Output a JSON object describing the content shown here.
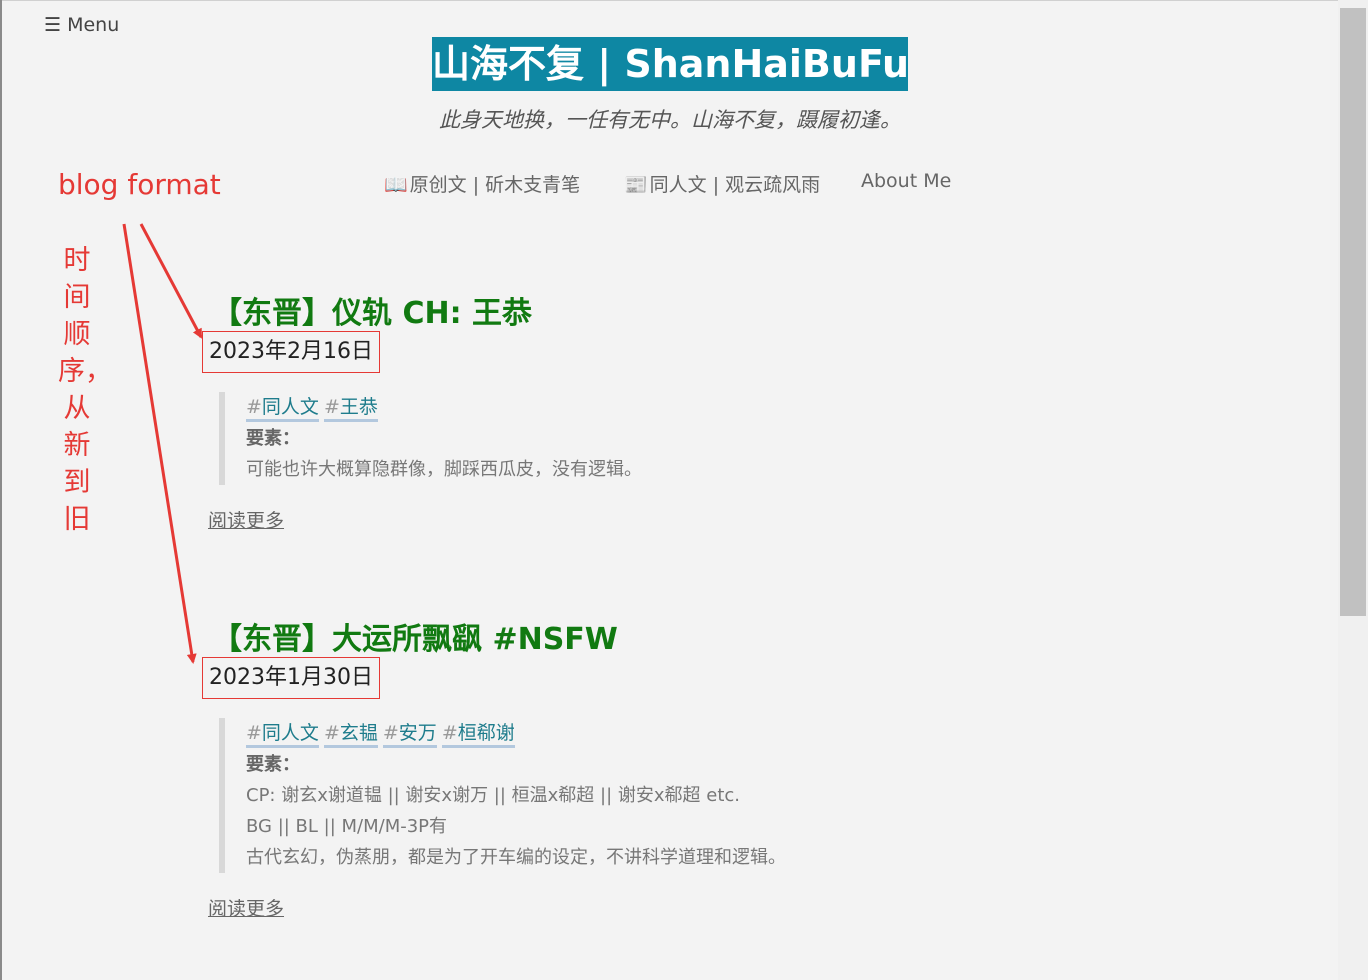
{
  "header": {
    "menu_label": "☰ Menu",
    "site_title": "山海不复 | ShanHaiBuFu",
    "tagline": "此身天地换，一任有无中。山海不复，蹑履初逢。"
  },
  "nav": {
    "items": [
      {
        "icon": "📖",
        "label": "原创文 | 斫木支青笔"
      },
      {
        "icon": "📰",
        "label": "同人文 | 观云疏风雨"
      },
      {
        "icon": "",
        "label": "About Me"
      }
    ]
  },
  "annotations": {
    "format_label": "blog format",
    "order_label": "时间顺序，从新到旧",
    "color": "#e53935"
  },
  "posts": [
    {
      "title": "【东晋】仪轨 CH: 王恭",
      "date": "2023年2月16日",
      "tags": [
        "同人文",
        "王恭"
      ],
      "label": "要素：",
      "lines": [
        "可能也许大概算隐群像，脚踩西瓜皮，没有逻辑。"
      ],
      "read_more": "阅读更多"
    },
    {
      "title": "【东晋】大运所飘飖 #NSFW",
      "date": "2023年1月30日",
      "tags": [
        "同人文",
        "玄韫",
        "安万",
        "桓郗谢"
      ],
      "label": "要素：",
      "lines": [
        "CP: 谢玄x谢道韫 || 谢安x谢万 || 桓温x郗超 || 谢安x郗超 etc.",
        "BG || BL || M/M/M-3P有",
        "古代玄幻，伪蒸朋，都是为了开车编的设定，不讲科学道理和逻辑。"
      ],
      "read_more": "阅读更多"
    }
  ],
  "tag_hash": "#",
  "colors": {
    "title_bg": "#0e87a3",
    "post_title": "#117a11",
    "tag_text": "#1e7c8c",
    "annotation": "#e53935"
  }
}
